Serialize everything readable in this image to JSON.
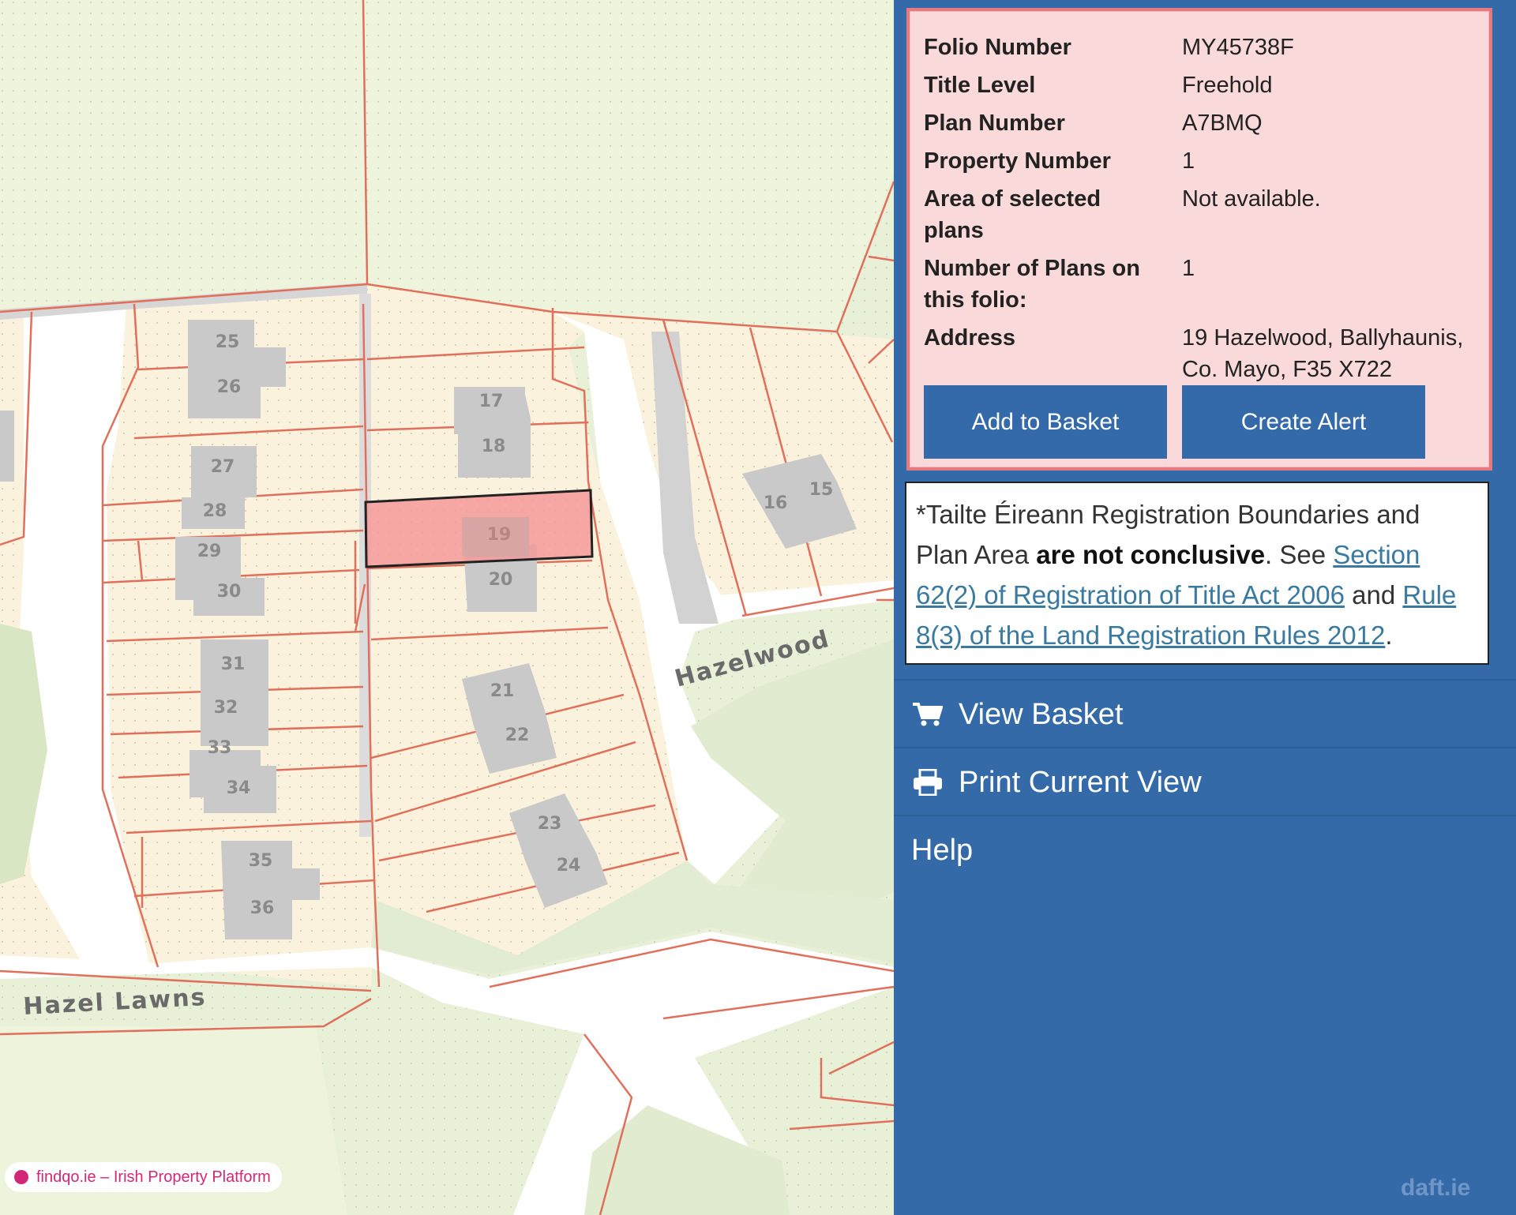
{
  "map": {
    "plot_numbers": [
      "25",
      "26",
      "27",
      "28",
      "29",
      "30",
      "31",
      "32",
      "33",
      "34",
      "35",
      "36",
      "17",
      "18",
      "19",
      "20",
      "21",
      "22",
      "23",
      "24",
      "16",
      "15"
    ],
    "road_labels": {
      "hazelwood": "Hazelwood",
      "hazel_lawns": "Hazel Lawns"
    },
    "selected_plot": "19",
    "colors": {
      "plot_fill": "#fbf2dd",
      "boundary": "#e0705c",
      "road": "#ffffff",
      "green": "#e8f0d8",
      "building": "#c9c9c9",
      "selected": "#f59a9a"
    }
  },
  "info": {
    "rows": [
      {
        "label": "Folio Number",
        "value": "MY45738F"
      },
      {
        "label": "Title Level",
        "value": "Freehold"
      },
      {
        "label": "Plan Number",
        "value": "A7BMQ"
      },
      {
        "label": "Property Number",
        "value": "1"
      },
      {
        "label": "Area of selected plans",
        "value": "Not available."
      },
      {
        "label": "Number of Plans on this folio:",
        "value": "1"
      },
      {
        "label": "Address",
        "value": "19 Hazelwood, Ballyhaunis, Co. Mayo, F35 X722"
      }
    ],
    "add_to_basket": "Add to Basket",
    "create_alert": "Create Alert"
  },
  "note": {
    "prefix": "*Tailte Éireann Registration Boundaries and Plan Area ",
    "bold": "are not conclusive",
    "mid": ". See ",
    "link1": "Section 62(2) of Registration of Title Act 2006",
    "and": " and ",
    "link2": "Rule 8(3) of the Land Registration Rules 2012",
    "end": "."
  },
  "menu": {
    "view_basket": "View Basket",
    "print_view": "Print Current View",
    "help": "Help"
  },
  "watermarks": {
    "daft": "daft.ie",
    "findqo": "findqo.ie – Irish Property Platform"
  },
  "colors": {
    "sidebar": "#346aa8",
    "button": "#356aaa",
    "info_bg": "#f9d9da",
    "info_border": "#e6797f"
  }
}
